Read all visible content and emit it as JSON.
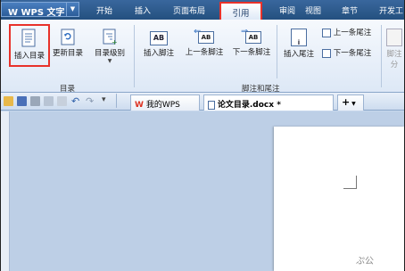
{
  "window": {
    "app_title": "WPS 文字"
  },
  "menu": {
    "tabs": [
      {
        "label": "开始"
      },
      {
        "label": "插入"
      },
      {
        "label": "页面布局"
      },
      {
        "label": "引用",
        "active": true
      },
      {
        "label": "审阅"
      },
      {
        "label": "视图"
      },
      {
        "label": "章节"
      },
      {
        "label": "开发工"
      }
    ]
  },
  "ribbon": {
    "toc_group": {
      "label": "目录",
      "insert_toc": "插入目录",
      "update_toc": "更新目录",
      "toc_level": "目录级别"
    },
    "footnote_group": {
      "label": "脚注和尾注",
      "insert_footnote": "插入脚注",
      "prev_footnote": "上一条脚注",
      "next_footnote": "下一条脚注",
      "insert_endnote": "插入尾注",
      "prev_endnote": "上一条尾注",
      "next_endnote": "下一条尾注",
      "footnote_icon_text": "AB",
      "endnote_icon_text": "AB"
    },
    "partial_label": "脚注",
    "partial_label2": "分"
  },
  "doc_tabs": {
    "my_wps": "我的WPS",
    "current_doc": "论文目录.docx *",
    "add_label": "+"
  },
  "watermark": "ぷ公",
  "colors": {
    "highlight": "#e8322a",
    "title_bar": "#2a5687",
    "ribbon_bg": "#eef3fa"
  }
}
